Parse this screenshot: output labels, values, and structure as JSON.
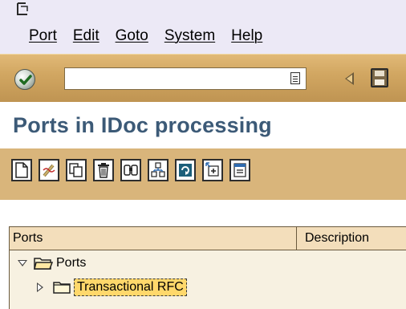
{
  "menu": {
    "items": [
      {
        "label": "Port"
      },
      {
        "label": "Edit"
      },
      {
        "label": "Goto"
      },
      {
        "label": "System"
      },
      {
        "label": "Help"
      }
    ]
  },
  "command_field": {
    "value": "",
    "placeholder": ""
  },
  "title": "Ports in IDoc processing",
  "toolbar": {
    "buttons": [
      {
        "icon": "create-icon"
      },
      {
        "icon": "change-icon"
      },
      {
        "icon": "copy-icon"
      },
      {
        "icon": "delete-icon"
      },
      {
        "icon": "find-icon"
      },
      {
        "icon": "where-used-icon"
      },
      {
        "icon": "refresh-icon"
      },
      {
        "icon": "expand-icon"
      },
      {
        "icon": "collapse-icon"
      }
    ]
  },
  "tree": {
    "columns": [
      "Ports",
      "Description"
    ],
    "rows": [
      {
        "label": "Ports",
        "expanded": true,
        "level": 0
      },
      {
        "label": "Transactional RFC",
        "expanded": false,
        "level": 1,
        "selected": true
      }
    ]
  },
  "colors": {
    "toolbar": "#d9b57b",
    "title": "#3c5a77",
    "menu_bg": "#ece9f6",
    "selection": "#ffd86b"
  }
}
